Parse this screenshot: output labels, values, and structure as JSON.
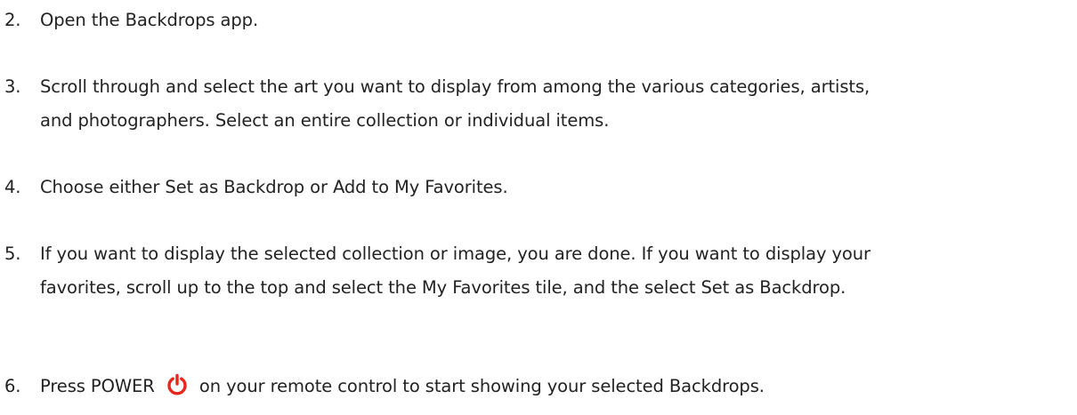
{
  "steps": [
    {
      "number": "2.",
      "text": "Open the Backdrops app."
    },
    {
      "number": "3.",
      "line1": "Scroll through and select the art you want to display from among the various categories, artists,",
      "line2": "and photographers. Select an entire collection or individual items."
    },
    {
      "number": "4.",
      "text": "Choose either Set as Backdrop or Add to My Favorites."
    },
    {
      "number": "5.",
      "line1": "If you want to display the selected collection or image, you are done. If you want to display your",
      "line2": "favorites, scroll up to the top and select the My Favorites tile, and the select Set as Backdrop."
    },
    {
      "number": "6.",
      "before_icon": "Press POWER",
      "after_icon": "on your remote control to start showing your selected Backdrops.",
      "icon": "power-icon",
      "icon_color": "#e8261c"
    }
  ]
}
